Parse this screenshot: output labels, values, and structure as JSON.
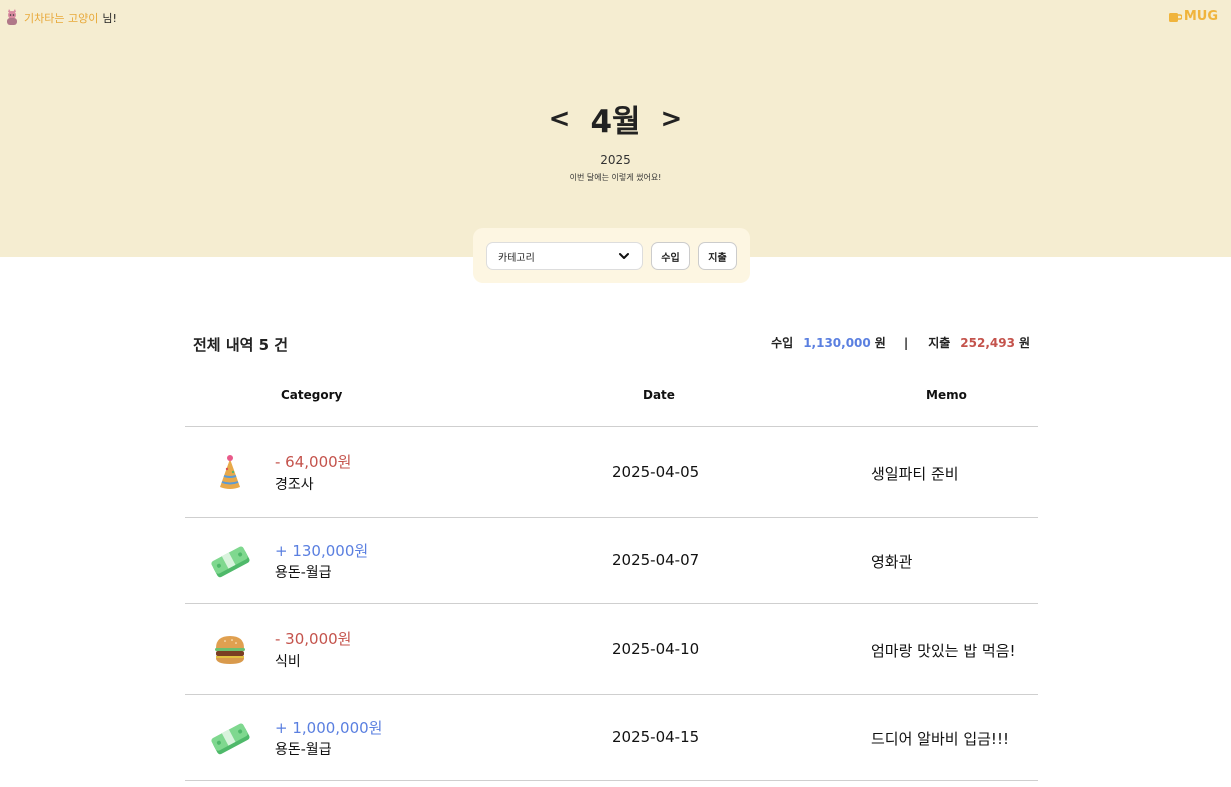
{
  "header": {
    "user_name": "기차타는 고양이",
    "user_suffix": "님!",
    "logo_text": "MUG"
  },
  "month_nav": {
    "prev": "<",
    "month": "4월",
    "next": ">",
    "year": "2025",
    "subtitle": "이번 달에는 이렇게 썼어요!"
  },
  "filters": {
    "category_placeholder": "카테고리",
    "income_label": "수입",
    "expense_label": "지출"
  },
  "summary": {
    "title": "전체 내역 5 건",
    "income_label": "수입",
    "income_value": "1,130,000",
    "separator": "|",
    "expense_label": "지출",
    "expense_value": "252,493",
    "unit": "원"
  },
  "table": {
    "headers": {
      "category": "Category",
      "date": "Date",
      "memo": "Memo"
    },
    "rows": [
      {
        "icon": "party-hat-icon",
        "amount": "- 64,000원",
        "type": "expense",
        "category": "경조사",
        "date": "2025-04-05",
        "memo": "생일파티 준비"
      },
      {
        "icon": "money-stack-icon",
        "amount": "+ 130,000원",
        "type": "income",
        "category": "용돈-월급",
        "date": "2025-04-07",
        "memo": "영화관"
      },
      {
        "icon": "hamburger-icon",
        "amount": "- 30,000원",
        "type": "expense",
        "category": "식비",
        "date": "2025-04-10",
        "memo": "엄마랑 맛있는 밥 먹음!"
      },
      {
        "icon": "money-stack-icon",
        "amount": "+ 1,000,000원",
        "type": "income",
        "category": "용돈-월급",
        "date": "2025-04-15",
        "memo": "드디어 알바비 입금!!!"
      }
    ]
  },
  "colors": {
    "hero_bg": "#f5edd1",
    "income": "#5a7fe0",
    "expense": "#c4534c",
    "accent": "#f0b43c"
  }
}
